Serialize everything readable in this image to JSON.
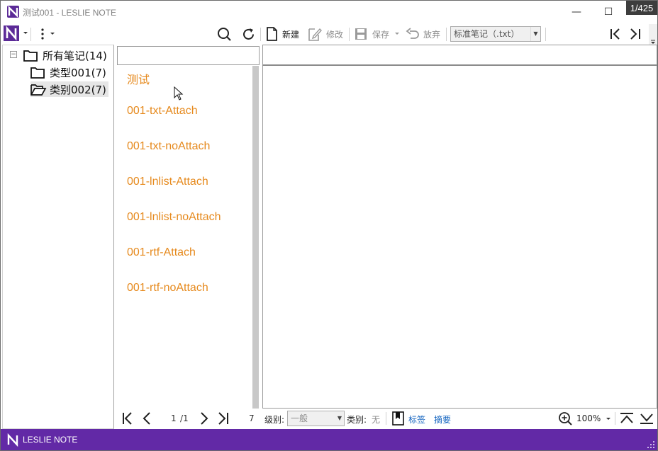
{
  "window": {
    "title": "测试001 - LESLIE NOTE",
    "counter": "1/425",
    "minimize_glyph": "—",
    "maximize_glyph": "☐",
    "close_glyph": "✕"
  },
  "toolbar": {
    "new_label": "新建",
    "edit_label": "修改",
    "save_label": "保存",
    "discard_label": "放弃",
    "format_value": "标准笔记（.txt）"
  },
  "tree": {
    "root": {
      "label": "所有笔记(14)",
      "expander": "⊟"
    },
    "children": [
      {
        "label": "类型001(7)"
      },
      {
        "label": "类别002(7)"
      }
    ]
  },
  "note_list": {
    "items": [
      "测试",
      "001-txt-Attach",
      "001-txt-noAttach",
      "001-lnlist-Attach",
      "001-lnlist-noAttach",
      "001-rtf-Attach",
      "001-rtf-noAttach"
    ],
    "page_current": "1",
    "page_total": "/1",
    "count": "7"
  },
  "editor_bar": {
    "level_label": "级别:",
    "level_value": "一般",
    "category_label": "类别:",
    "category_value": "无",
    "tags_link": "标签",
    "summary_link": "摘要",
    "zoom": "100%"
  },
  "status": {
    "brand": "LESLIE NOTE"
  },
  "colors": {
    "accent": "#6229a6",
    "note_title": "#e68a1e",
    "link": "#1565c0"
  }
}
